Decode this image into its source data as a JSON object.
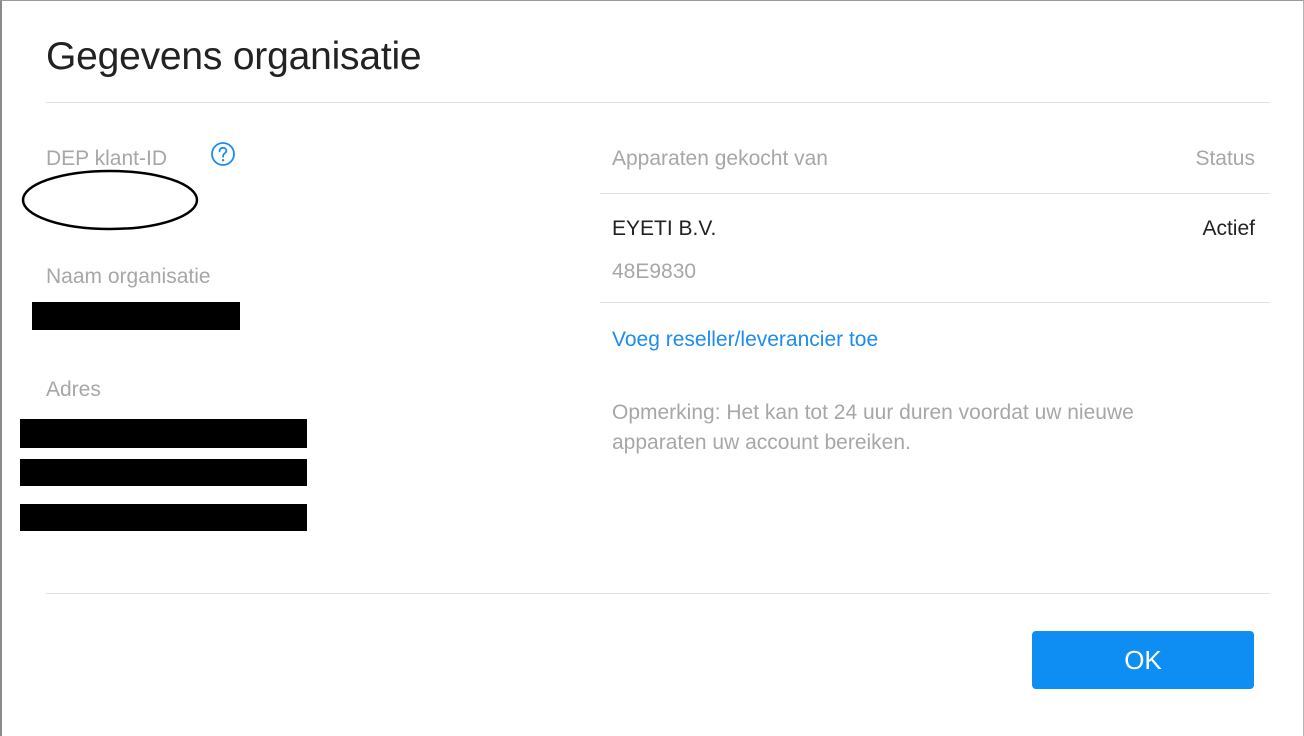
{
  "dialog": {
    "title": "Gegevens organisatie"
  },
  "left": {
    "customer_id_label": "DEP klant-ID",
    "organisation_name_label": "Naam organisatie",
    "address_label": "Adres"
  },
  "vendors": {
    "column_vendor_header": "Apparaten gekocht van",
    "column_status_header": "Status",
    "rows": [
      {
        "name": "EYETI B.V.",
        "id": "48E9830",
        "status": "Actief"
      }
    ],
    "add_link": "Voeg reseller/leverancier toe",
    "note": "Opmerking: Het kan tot 24 uur duren voordat uw nieuwe apparaten uw account bereiken."
  },
  "footer": {
    "ok_label": "OK"
  },
  "colors": {
    "accent": "#0e8ef3",
    "link": "#1c8cf0",
    "muted_text": "#a7a7a7",
    "primary_text": "#222222"
  },
  "icons": {
    "help": "question-circle-icon"
  }
}
